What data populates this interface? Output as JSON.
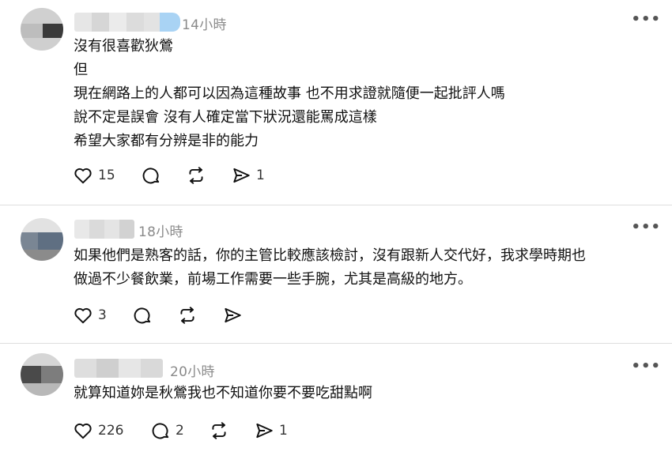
{
  "posts": [
    {
      "timestamp": "14小時",
      "lines": [
        "沒有很喜歡狄鶯",
        "但",
        "現在網路上的人都可以因為這種故事 也不用求證就隨便一起批評人嗎",
        "說不定是誤會 沒有人確定當下狀況還能罵成這樣",
        "希望大家都有分辨是非的能力"
      ],
      "likes": "15",
      "replies": "",
      "reposts": "",
      "shares": "1"
    },
    {
      "timestamp": "18小時",
      "lines": [
        "如果他們是熟客的話，你的主管比較應該檢討，沒有跟新人交代好，我求學時期也",
        "做過不少餐飲業，前場工作需要一些手腕，尤其是高級的地方。"
      ],
      "likes": "3",
      "replies": "",
      "reposts": "",
      "shares": ""
    },
    {
      "timestamp": "20小時",
      "lines": [
        "就算知道妳是秋鶯我也不知道你要不要吃甜點啊"
      ],
      "likes": "226",
      "replies": "2",
      "reposts": "",
      "shares": "1"
    }
  ],
  "more_label": "•••",
  "icons": {
    "like": "heart-icon",
    "reply": "comment-icon",
    "repost": "repost-icon",
    "share": "share-icon",
    "more": "more-options-icon"
  }
}
